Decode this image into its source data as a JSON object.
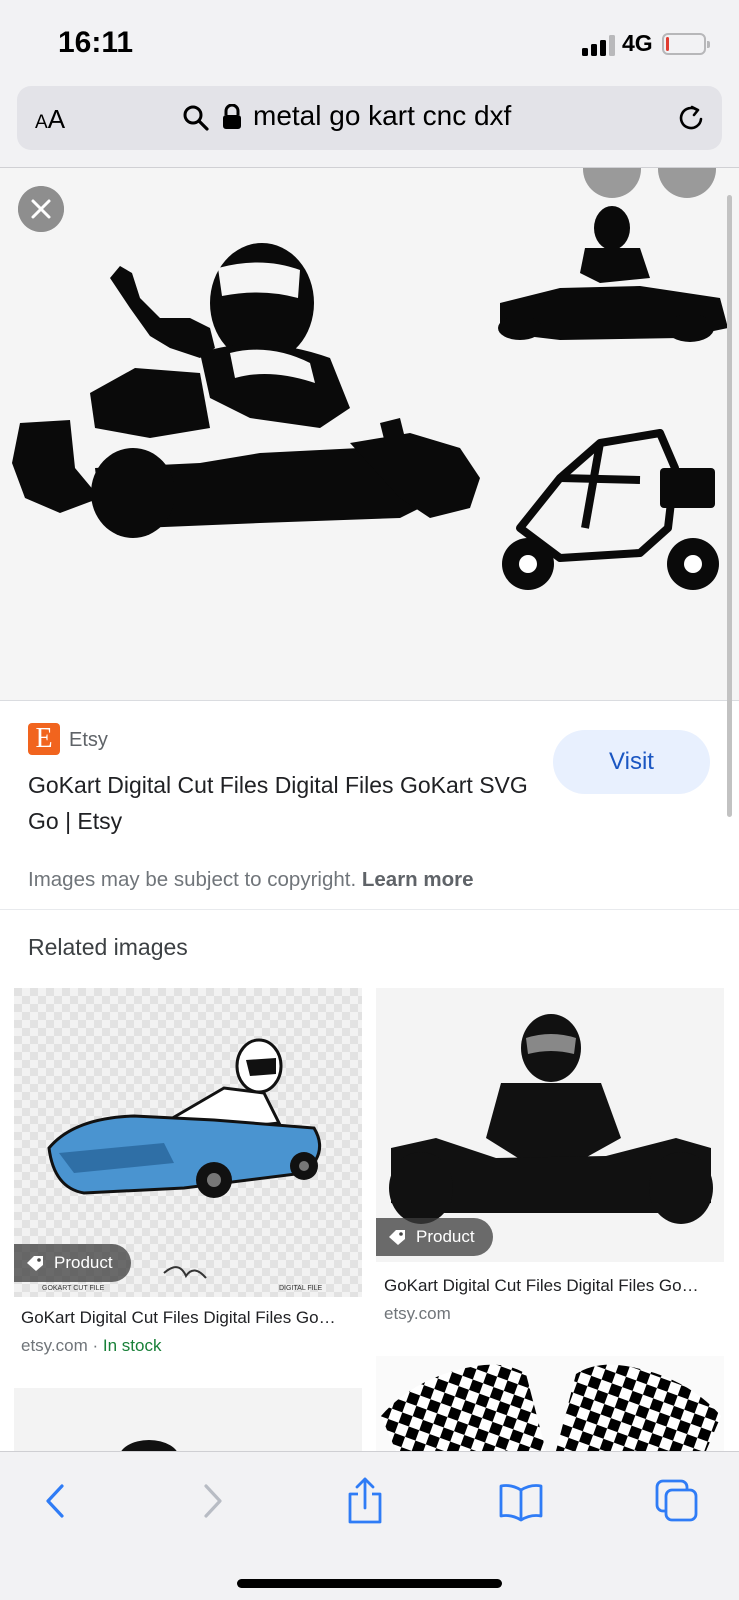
{
  "status_bar": {
    "time": "16:11",
    "network": "4G",
    "battery_level": 0.08
  },
  "browser": {
    "text_size_label_small": "A",
    "text_size_label_large": "A",
    "url_query": "metal go kart cnc dxf",
    "icons": [
      "search-icon",
      "lock-icon",
      "reload-icon"
    ]
  },
  "viewer": {
    "icons": [
      "close-icon"
    ]
  },
  "source": {
    "logo_letter": "E",
    "site_name": "Etsy",
    "title": "GoKart Digital Cut Files Digital Files GoKart SVG Go | Etsy",
    "visit_label": "Visit",
    "copyright_text": "Images may be subject to copyright.",
    "learn_more": "Learn more"
  },
  "related": {
    "heading": "Related images",
    "items": [
      {
        "badge": "Product",
        "title": "GoKart Digital Cut Files Digital Files Go…",
        "source": "etsy.com",
        "separator": " · ",
        "stock": "In stock",
        "label_cut": "GOKART CUT FILE",
        "label_formats": "DIGITAL FILE"
      },
      {
        "badge": "Product",
        "title": "GoKart Digital Cut Files Digital Files Go…",
        "source": "etsy.com"
      }
    ]
  },
  "toolbar": {
    "icons": [
      "back-icon",
      "forward-icon",
      "share-icon",
      "bookmarks-icon",
      "tabs-icon"
    ]
  },
  "colors": {
    "accent": "#1a56c2",
    "visit_bg": "#e8f0fe",
    "etsy": "#f1641e",
    "in_stock": "#188038",
    "kart_blue": "#4a94d0"
  }
}
